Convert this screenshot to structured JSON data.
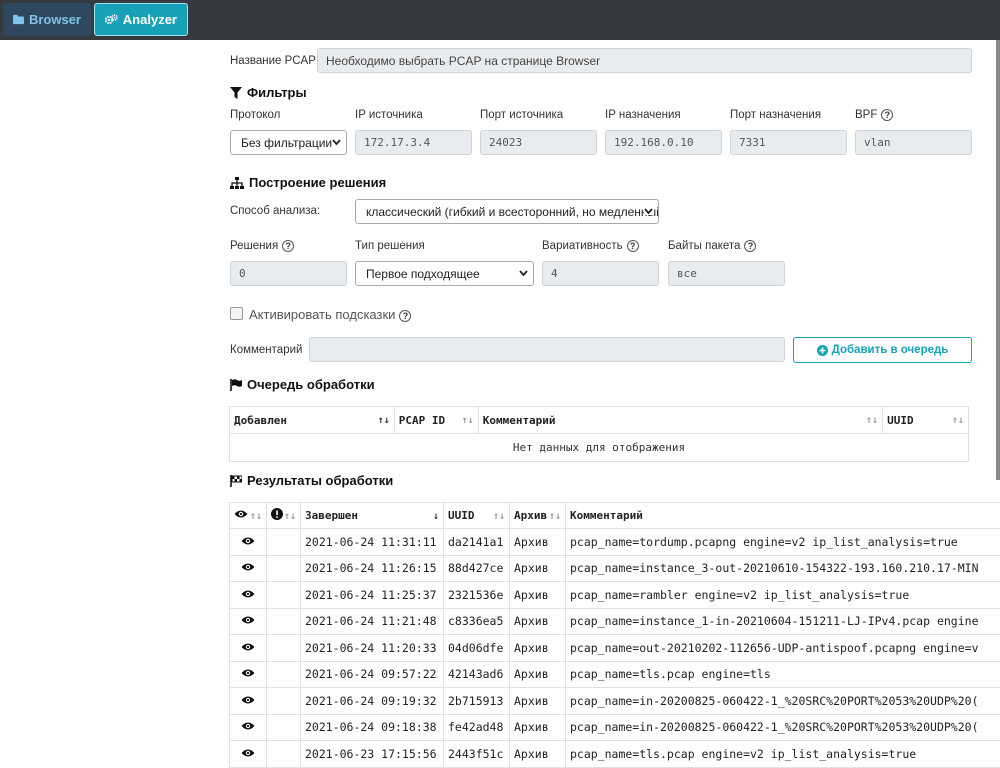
{
  "nav": {
    "browser": "Browser",
    "analyzer": "Analyzer"
  },
  "pcap": {
    "label": "Название PCAP",
    "value": "Необходимо выбрать PCAP на странице Browser"
  },
  "filters": {
    "heading": "Фильтры",
    "protocol_label": "Протокол",
    "protocol_value": "Без фильтрации",
    "src_ip_label": "IP источника",
    "src_ip_value": "172.17.3.4",
    "src_port_label": "Порт источника",
    "src_port_value": "24023",
    "dst_ip_label": "IP назначения",
    "dst_ip_value": "192.168.0.10",
    "dst_port_label": "Порт назначения",
    "dst_port_value": "7331",
    "bpf_label": "BPF",
    "bpf_value": "vlan"
  },
  "build": {
    "heading": "Построение решения",
    "method_label": "Способ анализа:",
    "method_value": "классический (гибкий и всесторонний, но медленный)",
    "solutions_label": "Решения",
    "solutions_value": "0",
    "type_label": "Тип решения",
    "type_value": "Первое подходящее",
    "variability_label": "Вариативность",
    "variability_value": "4",
    "bytes_label": "Байты пакета",
    "bytes_value": "все",
    "hints_label": "Активировать подсказки",
    "comment_label": "Комментарий",
    "add_button": "Добавить в очередь"
  },
  "queue": {
    "heading": "Очередь обработки",
    "columns": [
      "Добавлен",
      "PCAP ID",
      "Комментарий",
      "UUID"
    ],
    "empty": "Нет данных для отображения"
  },
  "results": {
    "heading": "Результаты обработки",
    "columns": {
      "finished": "Завершен",
      "uuid": "UUID",
      "archive": "Архив",
      "comment": "Комментарий"
    },
    "rows": [
      {
        "finished": "2021-06-24 11:31:11",
        "uuid": "da2141a1",
        "archive": "Архив",
        "comment": "pcap_name=tordump.pcapng engine=v2 ip_list_analysis=true"
      },
      {
        "finished": "2021-06-24 11:26:15",
        "uuid": "88d427ce",
        "archive": "Архив",
        "comment": "pcap_name=instance_3-out-20210610-154322-193.160.210.17-MIN"
      },
      {
        "finished": "2021-06-24 11:25:37",
        "uuid": "2321536e",
        "archive": "Архив",
        "comment": "pcap_name=rambler engine=v2 ip_list_analysis=true"
      },
      {
        "finished": "2021-06-24 11:21:48",
        "uuid": "c8336ea5",
        "archive": "Архив",
        "comment": "pcap_name=instance_1-in-20210604-151211-LJ-IPv4.pcap engine"
      },
      {
        "finished": "2021-06-24 11:20:33",
        "uuid": "04d06dfe",
        "archive": "Архив",
        "comment": "pcap_name=out-20210202-112656-UDP-antispoof.pcapng engine=v"
      },
      {
        "finished": "2021-06-24 09:57:22",
        "uuid": "42143ad6",
        "archive": "Архив",
        "comment": "pcap_name=tls.pcap engine=tls"
      },
      {
        "finished": "2021-06-24 09:19:32",
        "uuid": "2b715913",
        "archive": "Архив",
        "comment": "pcap_name=in-20200825-060422-1_%20SRC%20PORT%2053%20UDP%20("
      },
      {
        "finished": "2021-06-24 09:18:38",
        "uuid": "fe42ad48",
        "archive": "Архив",
        "comment": "pcap_name=in-20200825-060422-1_%20SRC%20PORT%2053%20UDP%20("
      },
      {
        "finished": "2021-06-23 17:15:56",
        "uuid": "2443f51c",
        "archive": "Архив",
        "comment": "pcap_name=tls.pcap engine=v2 ip_list_analysis=true"
      }
    ]
  }
}
